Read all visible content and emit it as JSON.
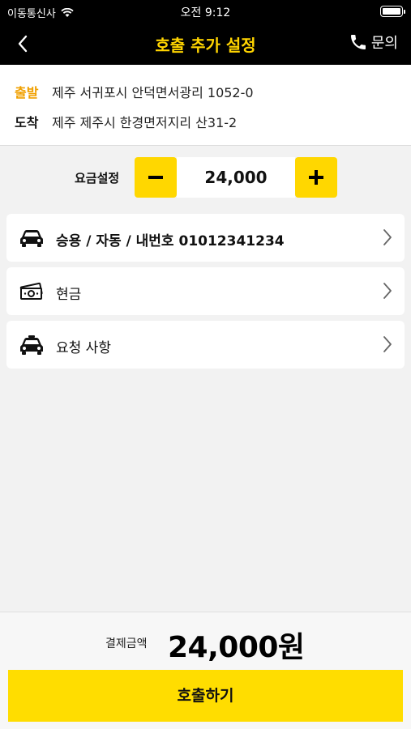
{
  "status_bar": {
    "carrier": "이동통신사",
    "time": "오전 9:12",
    "battery_level": 1.0
  },
  "header": {
    "title": "호출 추가 설정",
    "inquiry_label": "문의",
    "accent_color": "#ffd400"
  },
  "route": {
    "depart_tag": "출발",
    "depart_address": "제주 서귀포시 안덕면서광리 1052-0",
    "arrive_tag": "도착",
    "arrive_address": "제주 제주시 한경면저지리 산31-2",
    "depart_color": "#f0a000"
  },
  "fare": {
    "label": "요금설정",
    "value": "24,000",
    "minus_icon": "minus-icon",
    "plus_icon": "plus-icon"
  },
  "options": [
    {
      "icon": "car-icon",
      "label": "승용 / 자동 / 내번호 01012341234"
    },
    {
      "icon": "cash-icon",
      "label": "현금"
    },
    {
      "icon": "taxi-icon",
      "label": "요청 사항"
    }
  ],
  "payment": {
    "label": "결제금액",
    "amount": "24,000원"
  },
  "call_button": {
    "label": "호출하기",
    "color": "#ffdd00"
  }
}
